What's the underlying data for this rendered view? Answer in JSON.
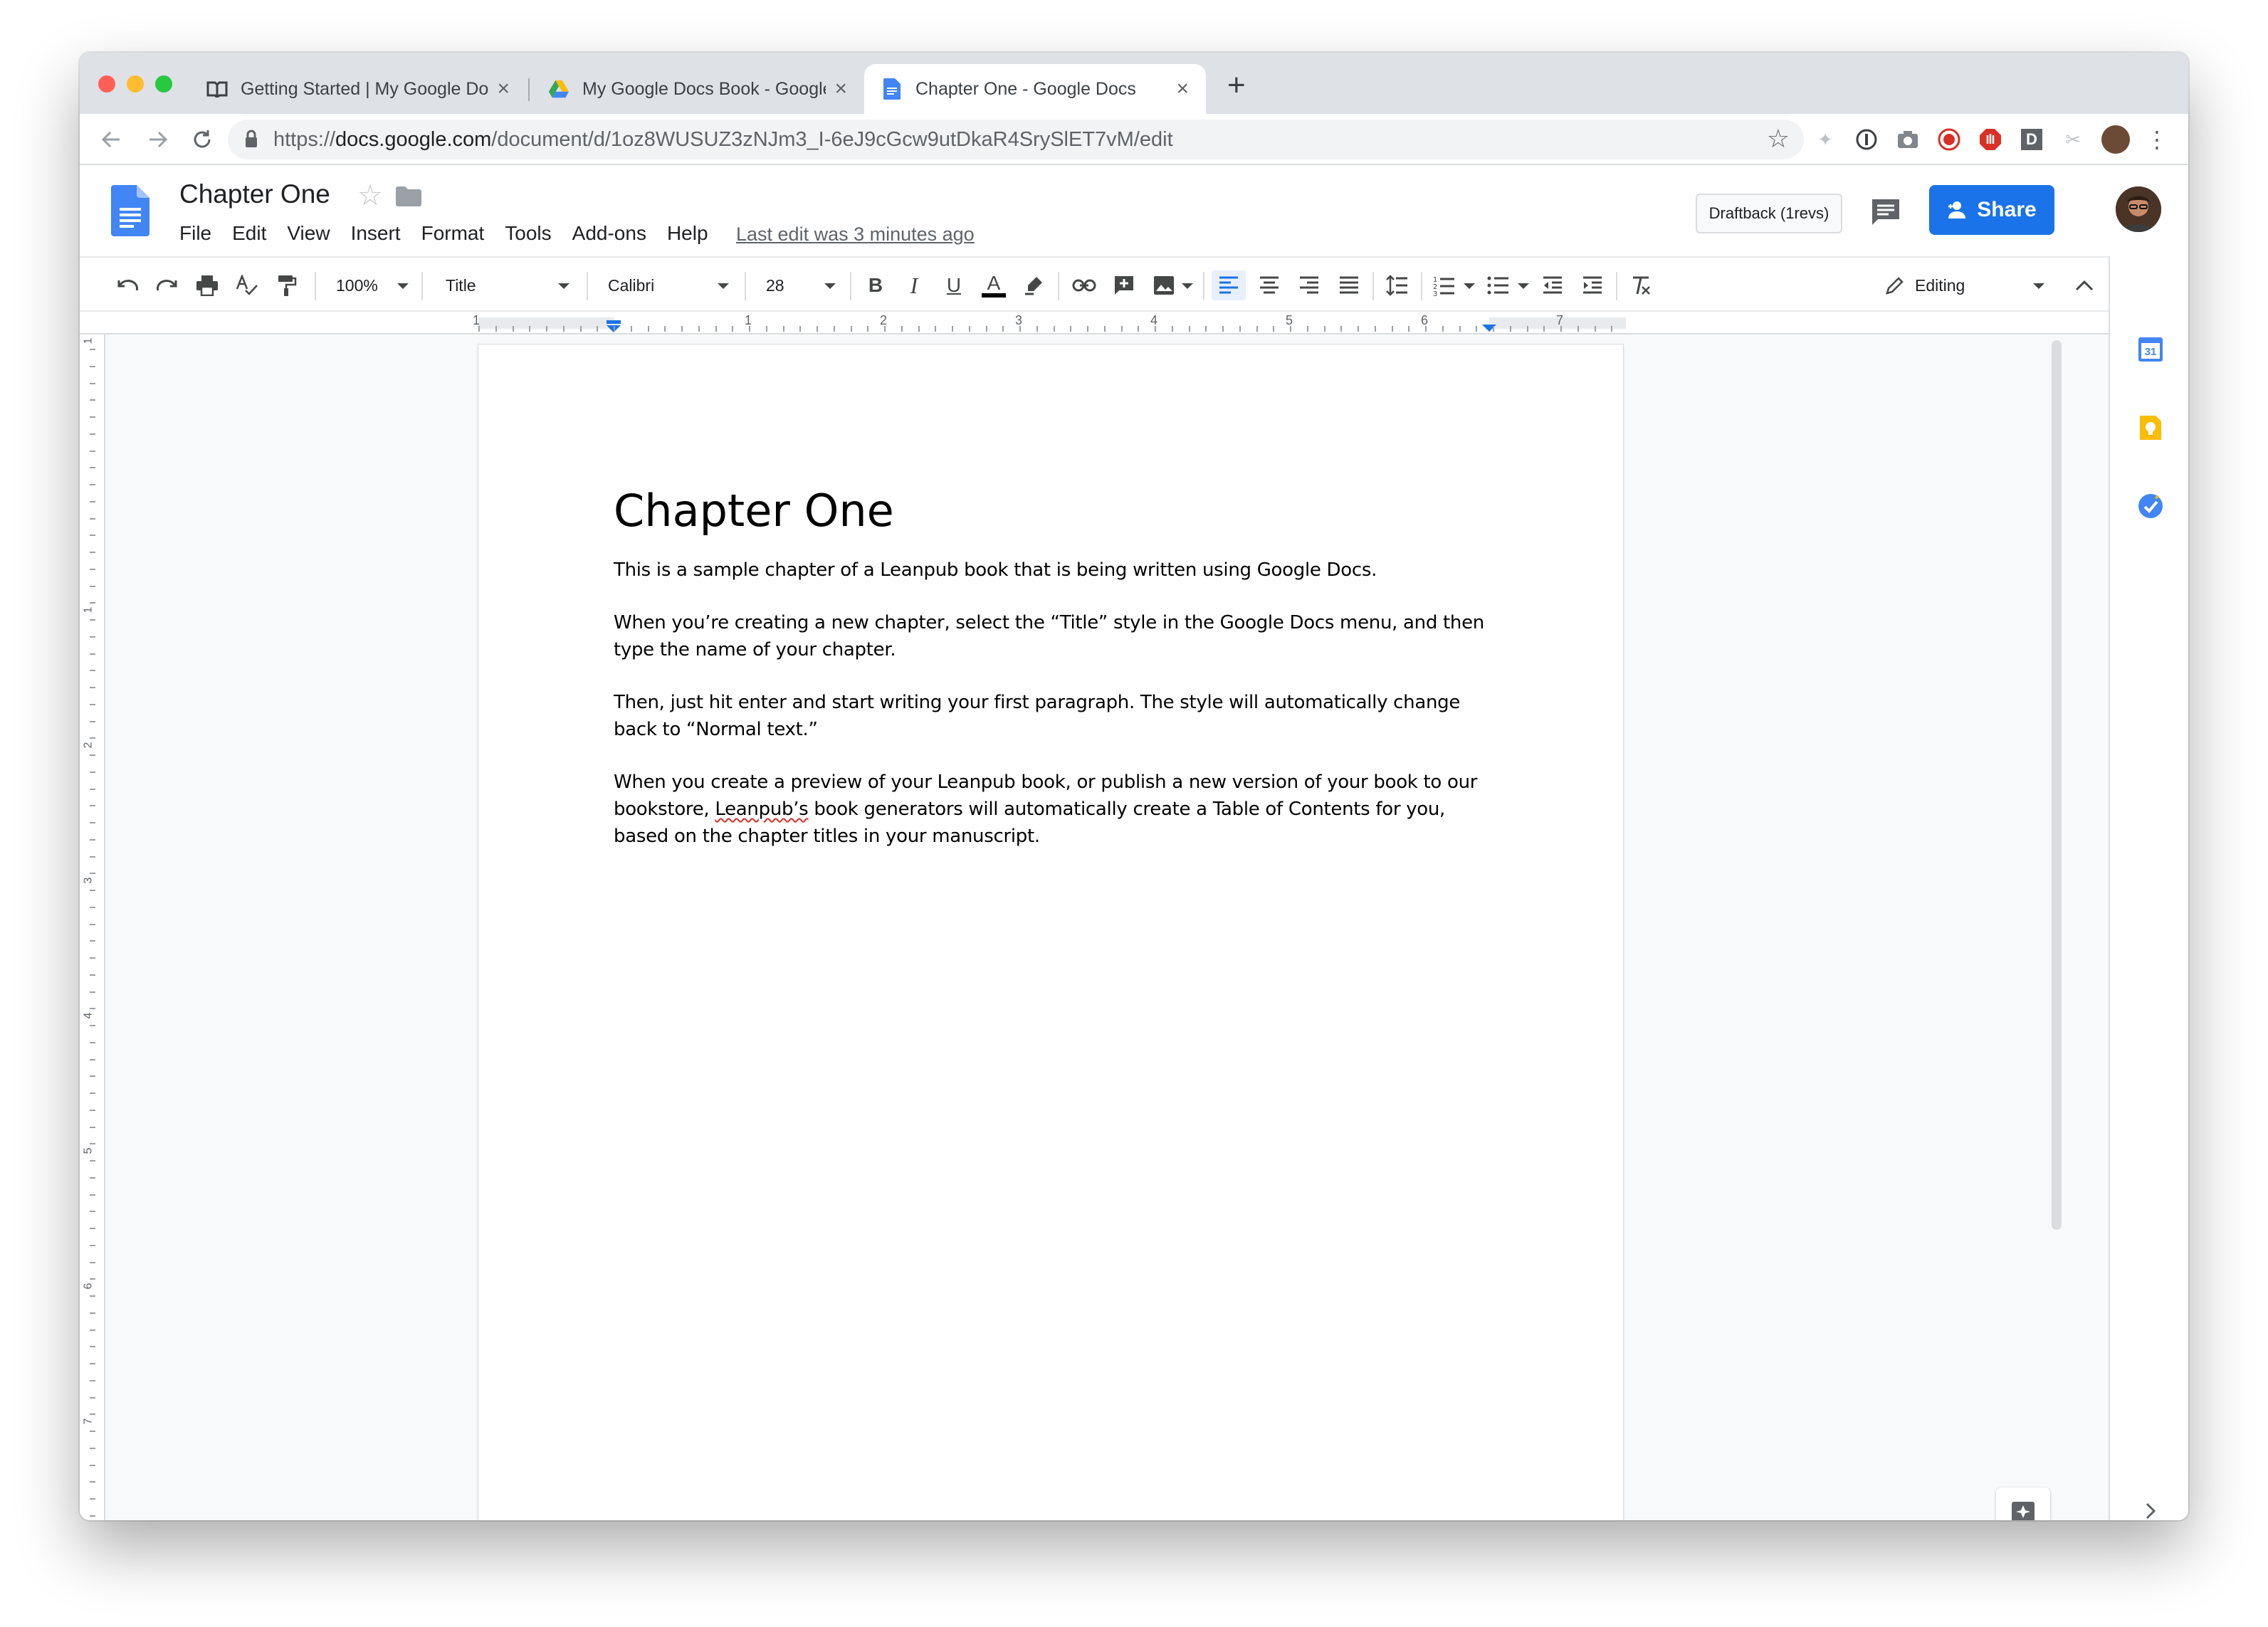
{
  "browser": {
    "tabs": [
      {
        "title": "Getting Started | My Google Docs Book",
        "icon": "book-icon",
        "active": false
      },
      {
        "title": "My Google Docs Book - Google Drive",
        "icon": "google-drive-icon",
        "active": false
      },
      {
        "title": "Chapter One - Google Docs",
        "icon": "google-docs-icon",
        "active": true
      }
    ],
    "tab_close": "×",
    "new_tab": "+",
    "url_scheme": "https://",
    "url_host": "docs.google.com",
    "url_path": "/document/d/1oz8WUSUZ3zNJm3_I-6eJ9cGcw9utDkaR4SrySlET7vM/edit"
  },
  "docs": {
    "title": "Chapter One",
    "menu": [
      "File",
      "Edit",
      "View",
      "Insert",
      "Format",
      "Tools",
      "Add-ons",
      "Help"
    ],
    "last_edit": "Last edit was 3 minutes ago",
    "draftback_label": "Draftback (1revs)",
    "share_label": "Share",
    "colors": {
      "accent": "#1a73e8",
      "docs_blue": "#4285f4"
    }
  },
  "toolbar": {
    "zoom": "100%",
    "style": "Title",
    "font": "Calibri",
    "font_size": "28",
    "mode": "Editing",
    "bold": "B",
    "italic": "I",
    "underline": "U",
    "text_color": "A"
  },
  "ruler": {
    "numbers": [
      "1",
      "1",
      "2",
      "3",
      "4",
      "5",
      "6",
      "7"
    ],
    "vertical_numbers": [
      "1",
      "1",
      "2",
      "3",
      "4",
      "5",
      "6",
      "7"
    ]
  },
  "side_panel": {
    "calendar_day": "31"
  },
  "document": {
    "heading": "Chapter One",
    "p1": "This is a sample chapter of a Leanpub book that is being written using Google Docs.",
    "p2": "When you’re creating a new chapter, select the “Title” style in the Google Docs menu, and then type the name of your chapter.",
    "p3": "Then, just hit enter and start writing your first paragraph. The style will automatically change back to “Normal text.”",
    "p4_before": "When you create a preview of your Leanpub book, or publish a new version of your book to our bookstore, ",
    "p4_misspelled": "Leanpub’s",
    "p4_after": " book generators will automatically create a Table of Contents for you, based on the chapter titles in your manuscript."
  }
}
